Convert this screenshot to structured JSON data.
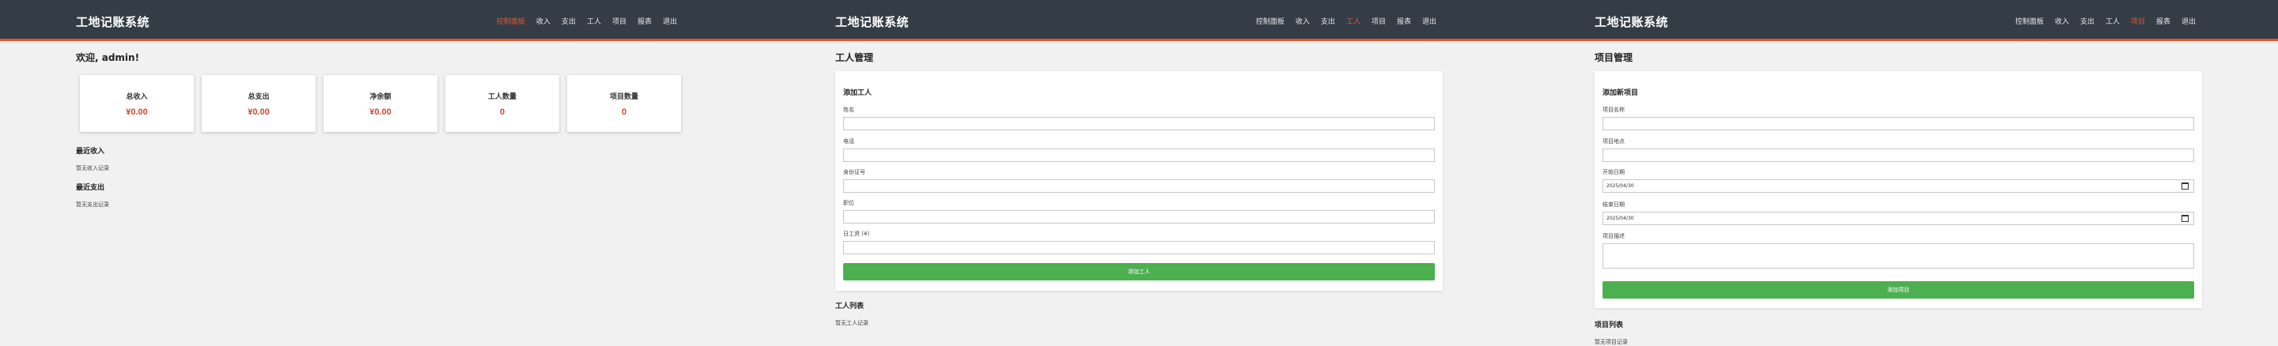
{
  "app_title": "工地记账系统",
  "nav": [
    "控制面板",
    "收入",
    "支出",
    "工人",
    "项目",
    "报表",
    "退出"
  ],
  "colors": {
    "header_bg": "#343d46",
    "accent": "#e3562f",
    "value": "#d2452a",
    "submit": "#4caf50"
  },
  "dashboard": {
    "welcome": "欢迎, admin!",
    "cards": [
      {
        "label": "总收入",
        "value": "¥0.00"
      },
      {
        "label": "总支出",
        "value": "¥0.00"
      },
      {
        "label": "净余额",
        "value": "¥0.00"
      },
      {
        "label": "工人数量",
        "value": "0"
      },
      {
        "label": "项目数量",
        "value": "0"
      }
    ],
    "recent_income_title": "最近收入",
    "recent_income_empty": "暂无收入记录",
    "recent_expense_title": "最近支出",
    "recent_expense_empty": "暂无支出记录"
  },
  "workers": {
    "title": "工人管理",
    "form_title": "添加工人",
    "fields": [
      "姓名",
      "电话",
      "身份证号",
      "职位",
      "日工资 (¥)"
    ],
    "submit": "添加工人",
    "list_title": "工人列表",
    "list_empty": "暂无工人记录"
  },
  "projects": {
    "title": "项目管理",
    "form_title": "添加新项目",
    "fields": [
      "项目名称",
      "项目地点",
      "开始日期",
      "结束日期",
      "项目描述"
    ],
    "start_date_value": "2025/04/30",
    "end_date_value": "2025/04/30",
    "submit": "添加项目",
    "list_title": "项目列表",
    "list_empty": "暂无项目记录"
  }
}
